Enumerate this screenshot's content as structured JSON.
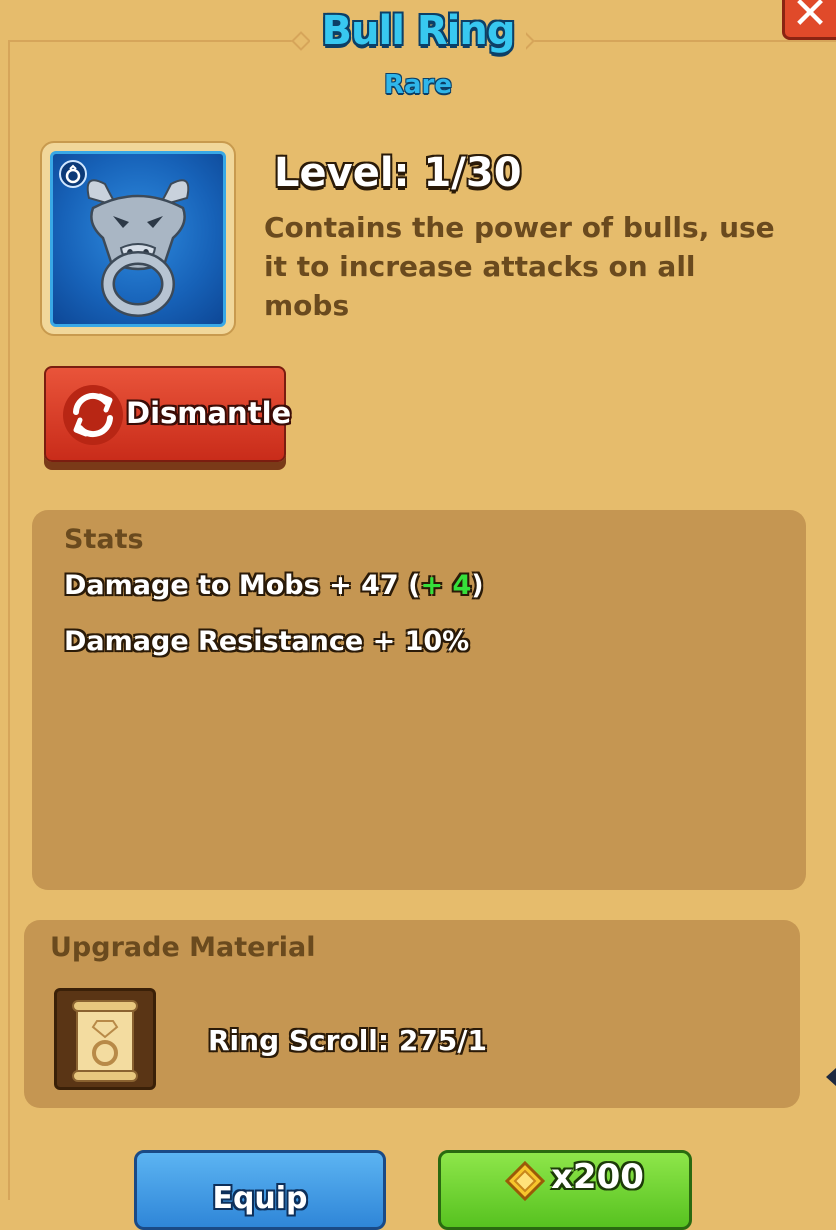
{
  "item": {
    "name": "Bull Ring",
    "rarity": "Rare",
    "level": "Level: 1/30",
    "description": "Contains the power of bulls, use it to increase attacks on all mobs",
    "icon": "bull-ring-icon"
  },
  "actions": {
    "close_label": "✕",
    "dismantle_label": "Dismantle",
    "equip_label": "Equip",
    "upgrade_cost": "x200"
  },
  "stats": {
    "heading": "Stats",
    "line1_text": "Damage to Mobs + 47 (",
    "line1_bonus_sign": "+",
    "line1_bonus_value": "4",
    "line1_close": ")",
    "line2_text": "Damage Resistance + 10%"
  },
  "upgrade": {
    "heading": "Upgrade Material",
    "material_label": "Ring Scroll: 275/1",
    "material_icon": "ring-scroll-icon"
  },
  "colors": {
    "background": "#e6bc6c",
    "panel": "#c59652",
    "title": "#38c8f0",
    "dismantle": "#d83a22",
    "equip": "#3f98e2",
    "upgrade": "#6ed22e",
    "bonus": "#36e03a"
  }
}
